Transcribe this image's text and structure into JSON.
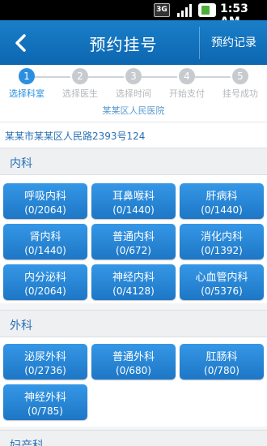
{
  "status_bar": {
    "network": "3G",
    "time": "1:53 AM",
    "icons": [
      "3g-icon",
      "signal-icon",
      "battery-icon"
    ]
  },
  "nav": {
    "title": "预约挂号",
    "right_button": "预约记录",
    "back_icon": "chevron-left-icon"
  },
  "steps": [
    {
      "num": "1",
      "label": "选择科室",
      "active": true
    },
    {
      "num": "2",
      "label": "选择医生",
      "active": false
    },
    {
      "num": "3",
      "label": "选择时间",
      "active": false
    },
    {
      "num": "4",
      "label": "开始支付",
      "active": false
    },
    {
      "num": "5",
      "label": "挂号成功",
      "active": false
    }
  ],
  "hospital_name": "某某区人民医院",
  "address": "某某市某某区人民路2393号124",
  "sections": [
    {
      "title": "内科",
      "departments": [
        {
          "name": "呼吸内科",
          "count": "(0/2064)"
        },
        {
          "name": "耳鼻喉科",
          "count": "(0/1440)"
        },
        {
          "name": "肝病科",
          "count": "(0/1440)"
        },
        {
          "name": "肾内科",
          "count": "(0/1440)"
        },
        {
          "name": "普通内科",
          "count": "(0/672)"
        },
        {
          "name": "消化内科",
          "count": "(0/1392)"
        },
        {
          "name": "内分泌科",
          "count": "(0/2064)"
        },
        {
          "name": "神经内科",
          "count": "(0/4128)"
        },
        {
          "name": "心血管内科",
          "count": "(0/5376)"
        }
      ]
    },
    {
      "title": "外科",
      "departments": [
        {
          "name": "泌尿外科",
          "count": "(0/2736)"
        },
        {
          "name": "普通外科",
          "count": "(0/680)"
        },
        {
          "name": "肛肠科",
          "count": "(0/780)"
        },
        {
          "name": "神经外科",
          "count": "(0/785)"
        }
      ]
    },
    {
      "title": "妇产科",
      "departments": []
    }
  ],
  "colors": {
    "nav_bar": "#1273bd",
    "accent": "#2b8fe0",
    "button": "#2585d6",
    "link_text": "#2a71b5"
  }
}
